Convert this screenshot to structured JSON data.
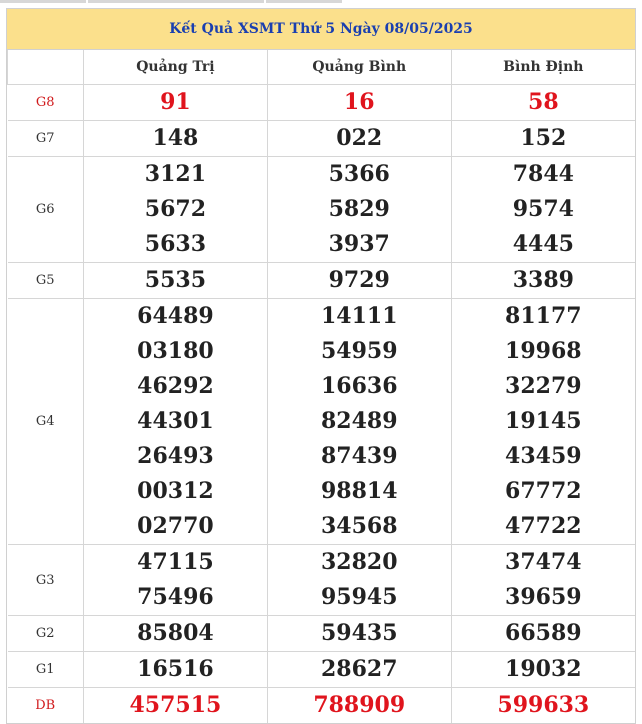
{
  "title": "Kết Quả XSMT Thứ 5 Ngày 08/05/2025",
  "headers": [
    "",
    "Quảng Trị",
    "Quảng Bình",
    "Bình Định"
  ],
  "prizes": [
    {
      "label": "G8",
      "highlight": true,
      "values": [
        [
          "91"
        ],
        [
          "16"
        ],
        [
          "58"
        ]
      ]
    },
    {
      "label": "G7",
      "highlight": false,
      "values": [
        [
          "148"
        ],
        [
          "022"
        ],
        [
          "152"
        ]
      ]
    },
    {
      "label": "G6",
      "highlight": false,
      "values": [
        [
          "3121",
          "5672",
          "5633"
        ],
        [
          "5366",
          "5829",
          "3937"
        ],
        [
          "7844",
          "9574",
          "4445"
        ]
      ]
    },
    {
      "label": "G5",
      "highlight": false,
      "values": [
        [
          "5535"
        ],
        [
          "9729"
        ],
        [
          "3389"
        ]
      ]
    },
    {
      "label": "G4",
      "highlight": false,
      "values": [
        [
          "64489",
          "03180",
          "46292",
          "44301",
          "26493",
          "00312",
          "02770"
        ],
        [
          "14111",
          "54959",
          "16636",
          "82489",
          "87439",
          "98814",
          "34568"
        ],
        [
          "81177",
          "19968",
          "32279",
          "19145",
          "43459",
          "67772",
          "47722"
        ]
      ]
    },
    {
      "label": "G3",
      "highlight": false,
      "values": [
        [
          "47115",
          "75496"
        ],
        [
          "32820",
          "95945"
        ],
        [
          "37474",
          "39659"
        ]
      ]
    },
    {
      "label": "G2",
      "highlight": false,
      "values": [
        [
          "85804"
        ],
        [
          "59435"
        ],
        [
          "66589"
        ]
      ]
    },
    {
      "label": "G1",
      "highlight": false,
      "values": [
        [
          "16516"
        ],
        [
          "28627"
        ],
        [
          "19032"
        ]
      ]
    },
    {
      "label": "DB",
      "highlight": true,
      "values": [
        [
          "457515"
        ],
        [
          "788909"
        ],
        [
          "599633"
        ]
      ]
    }
  ],
  "colors": {
    "title_bg": "#fbe08c",
    "title_text": "#1a3fb0",
    "highlight": "#e0141d"
  }
}
